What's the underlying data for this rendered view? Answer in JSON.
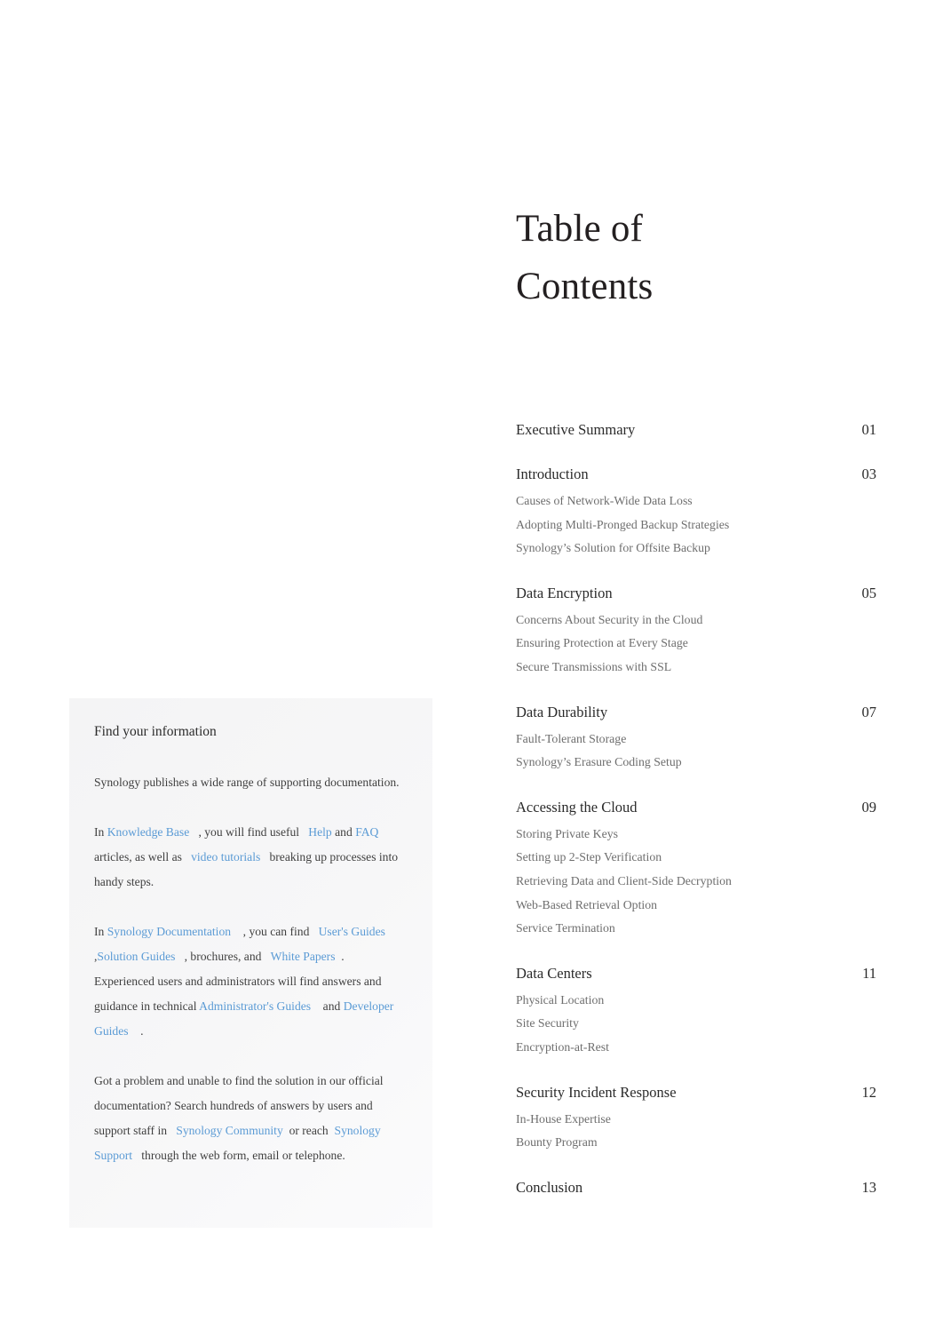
{
  "document": {
    "heading_line1": "Table of",
    "heading_line2": "Contents"
  },
  "toc": {
    "sections": [
      {
        "title": "Executive Summary",
        "page": "01",
        "subsections": []
      },
      {
        "title": "Introduction",
        "page": "03",
        "subsections": [
          "Causes of Network-Wide Data Loss",
          "Adopting Multi-Pronged Backup Strategies",
          "Synology’s Solution for Offsite Backup"
        ]
      },
      {
        "title": "Data Encryption",
        "page": "05",
        "subsections": [
          "Concerns About Security in the Cloud",
          "Ensuring Protection at Every Stage",
          "Secure Transmissions with SSL"
        ]
      },
      {
        "title": "Data Durability",
        "page": "07",
        "subsections": [
          "Fault-Tolerant Storage",
          "Synology’s Erasure Coding Setup"
        ]
      },
      {
        "title": "Accessing the Cloud",
        "page": "09",
        "subsections": [
          "Storing Private Keys",
          "Setting up 2-Step Verification",
          "Retrieving Data and Client-Side Decryption",
          "Web-Based Retrieval Option",
          "Service Termination"
        ]
      },
      {
        "title": "Data Centers",
        "page": "11",
        "subsections": [
          "Physical Location",
          "Site Security",
          "Encryption-at-Rest"
        ]
      },
      {
        "title": "Security Incident Response",
        "page": "12",
        "subsections": [
          "In-House Expertise",
          "Bounty Program"
        ]
      },
      {
        "title": "Conclusion",
        "page": "13",
        "subsections": []
      }
    ]
  },
  "info_card": {
    "title": "Find your information",
    "paragraph1": "Synology publishes a wide range of supporting documentation.",
    "paragraph2": {
      "t1": "In",
      "link_knowledge_base": "Knowledge Base",
      "t2": ", you will find useful",
      "link_help": "Help",
      "t3": "and",
      "link_faq": "FAQ",
      "t4": "articles, as well as",
      "link_video_tutorials": "video tutorials",
      "t5": "breaking up processes into handy steps."
    },
    "paragraph3": {
      "t1": "In",
      "link_synology_documentation": "Synology Documentation",
      "t2": ", you can find",
      "link_users_guides": "User's Guides",
      "t3": ",",
      "link_solution_guides": "Solution Guides",
      "t4": ", brochures, and",
      "link_white_papers": "White Papers",
      "t5": ". Experienced users and administrators will find answers and guidance in technical",
      "link_administrators_guides": "Administrator's Guides",
      "t6": "and",
      "link_developer_guides": "Developer Guides",
      "t7": "."
    },
    "paragraph4": {
      "t1": "Got a problem and unable to find the solution in our official documentation? Search hundreds of answers by users and support staff in",
      "link_synology_community": "Synology Community",
      "t2": "or reach",
      "link_synology_support": "Synology Support",
      "t3": "through the web form, email or telephone."
    }
  },
  "colors": {
    "link": "#5b9bd5",
    "heading": "#231f20",
    "section_title": "#2b2b2b",
    "subsection": "#6e6e6e",
    "card_background": "#f6f6f7",
    "page_background": "#ffffff"
  }
}
